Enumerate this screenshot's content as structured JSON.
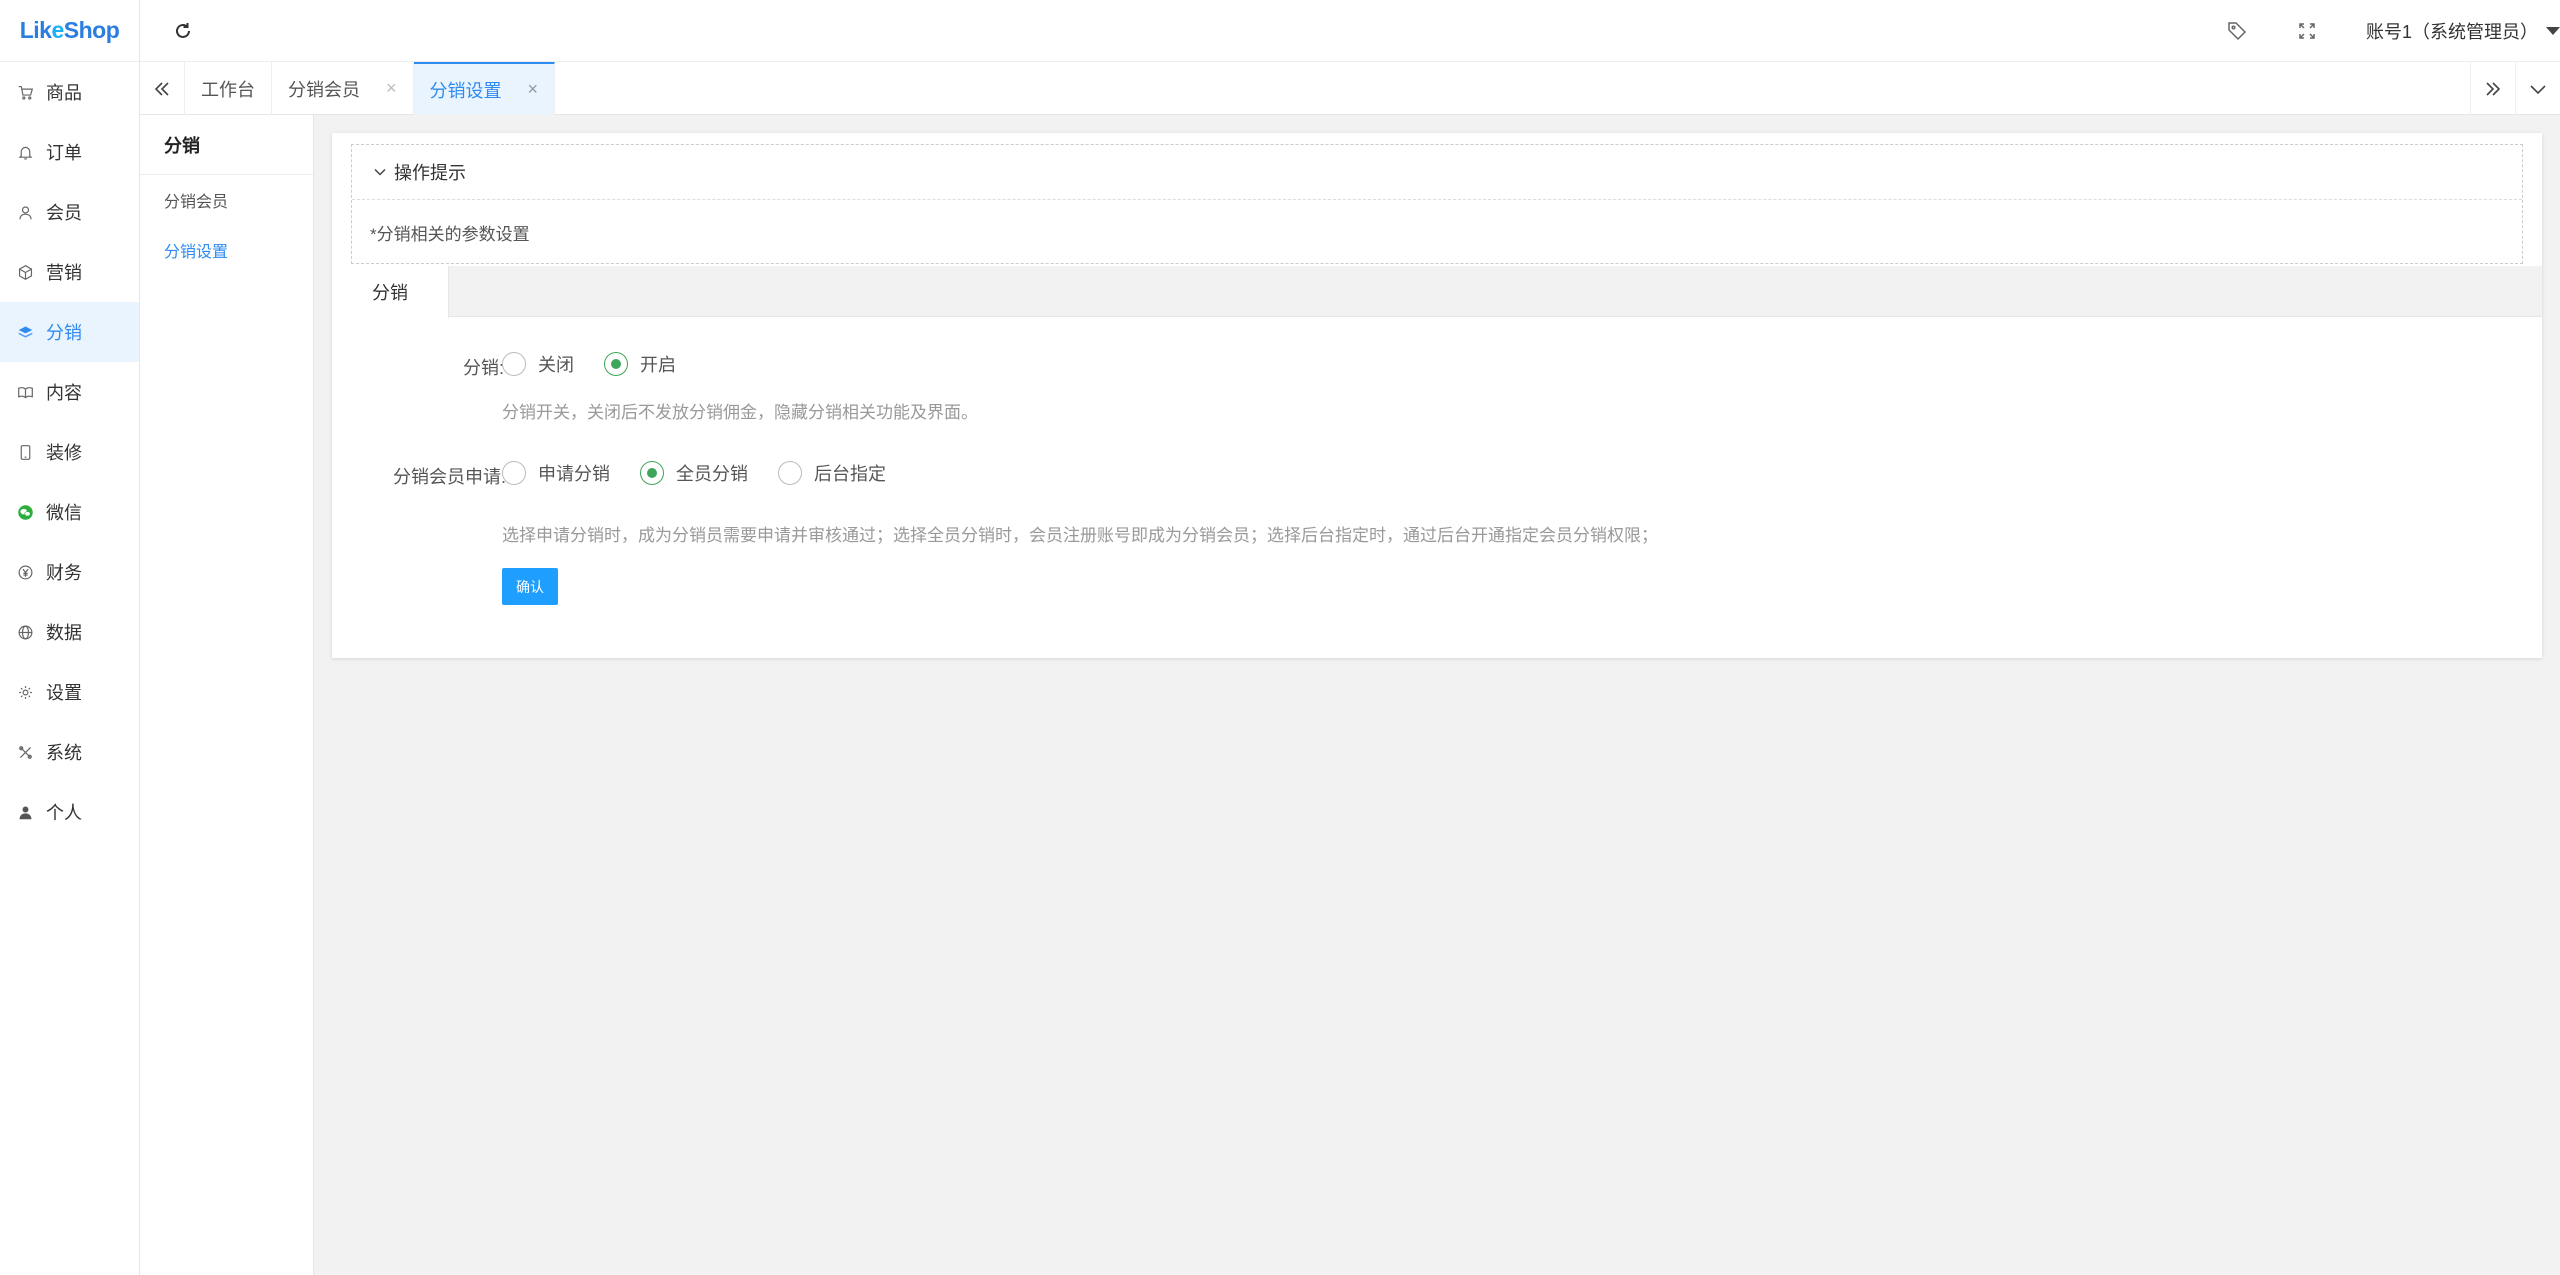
{
  "app": {
    "logo": {
      "part1": "Lik",
      "part2": "e",
      "part3": "Shop"
    }
  },
  "sidebar": {
    "items": [
      {
        "label": "商品",
        "icon": "cart-icon"
      },
      {
        "label": "订单",
        "icon": "bell-icon"
      },
      {
        "label": "会员",
        "icon": "user-icon"
      },
      {
        "label": "营销",
        "icon": "cube-icon"
      },
      {
        "label": "分销",
        "icon": "layers-icon",
        "active": true
      },
      {
        "label": "内容",
        "icon": "book-icon"
      },
      {
        "label": "装修",
        "icon": "phone-icon"
      },
      {
        "label": "微信",
        "icon": "wechat-icon"
      },
      {
        "label": "财务",
        "icon": "yen-icon"
      },
      {
        "label": "数据",
        "icon": "globe-icon"
      },
      {
        "label": "设置",
        "icon": "gear-icon"
      },
      {
        "label": "系统",
        "icon": "tools-icon"
      },
      {
        "label": "个人",
        "icon": "person-icon"
      }
    ]
  },
  "header": {
    "account": "账号1（系统管理员）"
  },
  "tabs": [
    {
      "label": "工作台",
      "closable": false
    },
    {
      "label": "分销会员",
      "closable": true
    },
    {
      "label": "分销设置",
      "closable": true,
      "active": true
    }
  ],
  "tab_close": "×",
  "subnav": {
    "title": "分销",
    "items": [
      {
        "label": "分销会员"
      },
      {
        "label": "分销设置",
        "active": true
      }
    ]
  },
  "tips": {
    "title": "操作提示",
    "body": "*分销相关的参数设置"
  },
  "content_tab": "分销",
  "form": {
    "distribution": {
      "label": "分销:",
      "options": [
        "关闭",
        "开启"
      ],
      "selected": "开启",
      "hint": "分销开关，关闭后不发放分销佣金，隐藏分销相关功能及界面。"
    },
    "apply": {
      "label": "分销会员申请:",
      "options": [
        "申请分销",
        "全员分销",
        "后台指定"
      ],
      "selected": "全员分销",
      "hint": "选择申请分销时，成为分销员需要申请并审核通过；选择全员分销时，会员注册账号即成为分销会员；选择后台指定时，通过后台开通指定会员分销权限；"
    },
    "submit": "确认"
  },
  "colors": {
    "accent": "#2f8bf0",
    "radio_checked": "#3fa55b",
    "button": "#1e9fff"
  }
}
